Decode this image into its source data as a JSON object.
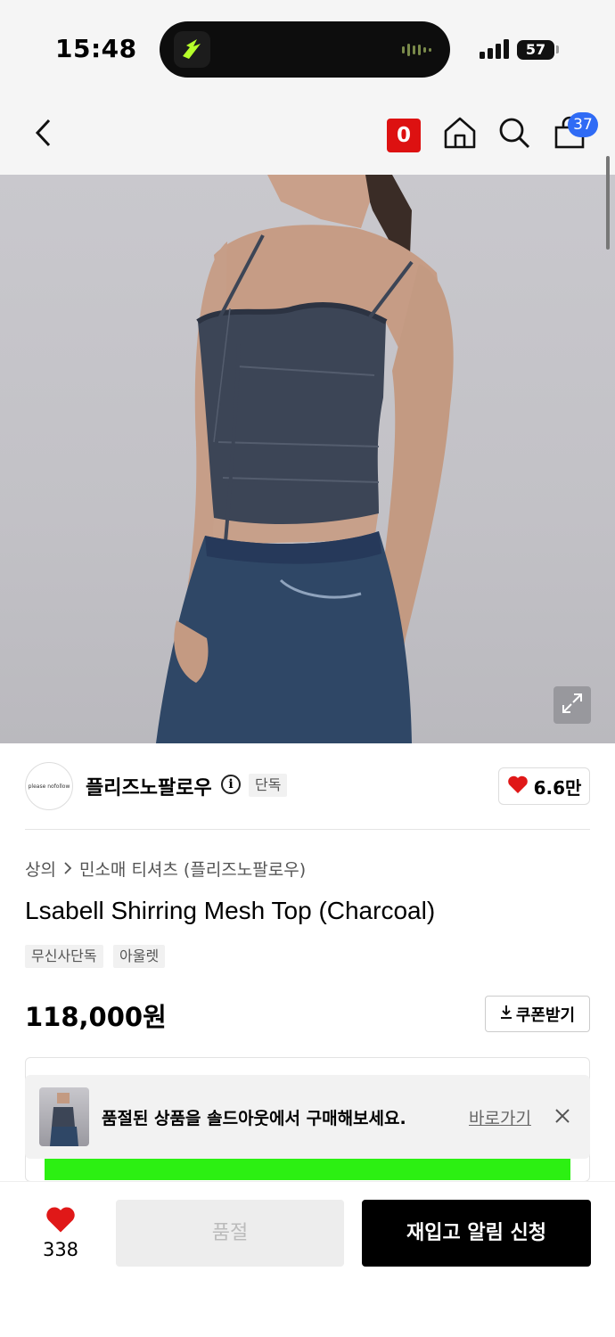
{
  "status_bar": {
    "time": "15:48",
    "battery": "57"
  },
  "header": {
    "back_icon": "chevron-left-icon",
    "points_badge": "0",
    "home_icon": "home-icon",
    "search_icon": "search-icon",
    "cart_icon": "shopping-bag-icon",
    "cart_count": "37"
  },
  "brand": {
    "logo_text": "please nofollow",
    "name": "플리즈노팔로우",
    "exclusive_tag": "단독",
    "likes": "6.6만"
  },
  "product": {
    "breadcrumb": [
      "상의",
      "민소매 티셔츠 (플리즈노팔로우)"
    ],
    "title": "Lsabell Shirring Mesh Top (Charcoal)",
    "tags": [
      "무신사단독",
      "아울렛"
    ],
    "price": "118,000원",
    "coupon_label": "쿠폰받기"
  },
  "toast": {
    "message": "품절된 상품을 솔드아웃에서 구매해보세요.",
    "link": "바로가기"
  },
  "bottom_bar": {
    "like_count": "338",
    "soldout_label": "품절",
    "restock_label": "재입고 알림 신청"
  },
  "colors": {
    "accent_red": "#e01818",
    "cart_badge": "#2f6bf5",
    "banner_green": "#2cf012"
  }
}
